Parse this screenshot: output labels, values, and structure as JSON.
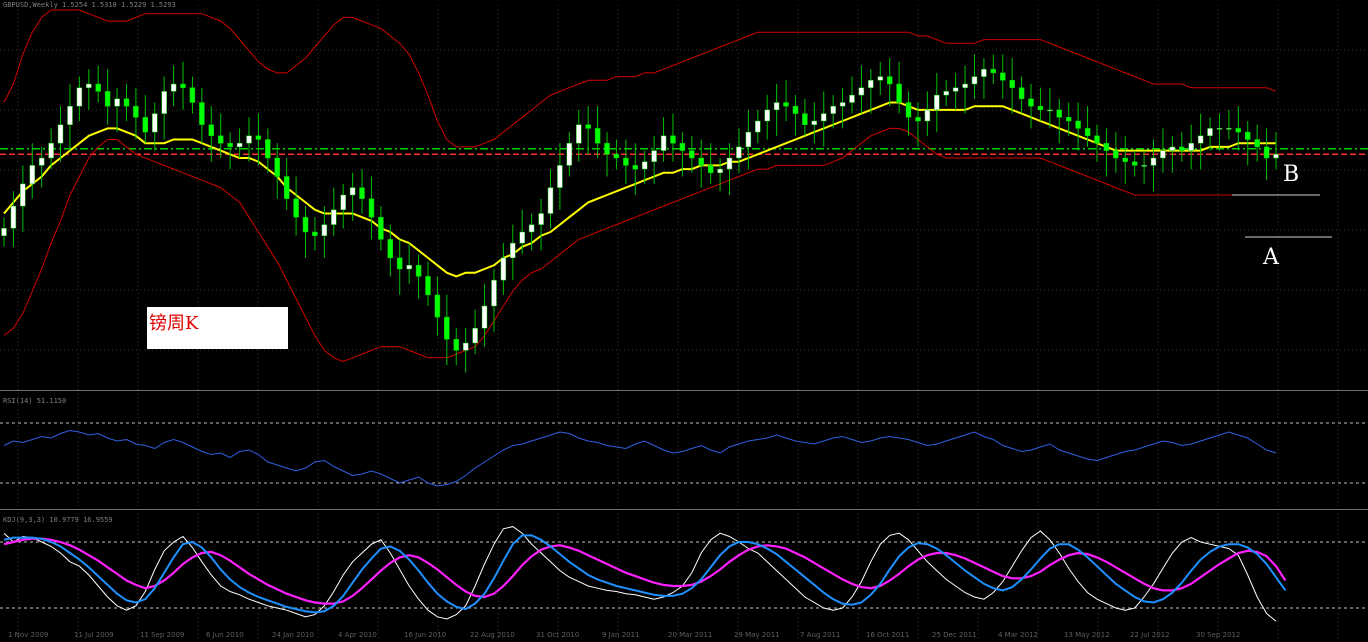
{
  "main_header": "GBPUSD,Weekly  1.5254 1.5318 1.5229 1.5293",
  "rsi_header": "RSI(14) 51.1150",
  "stoch_header": "KDJ(9,3,3) 10.9779 16.9559",
  "note": {
    "text": "镑周K"
  },
  "labels": {
    "a": "A",
    "b": "B"
  },
  "x_ticks": [
    "1 Nov 2009",
    "11 Jul 2009",
    "11 Sep 2009",
    "6 Jun 2010",
    "24 Jan 2010",
    "4 Apr 2010",
    "16 Jun 2010",
    "22 Aug 2010",
    "31 Oct 2010",
    "9 Jan 2011",
    "20 Mar 2011",
    "29 May 2011",
    "7 Aug 2011",
    "16 Oct 2011",
    "25 Dec 2011",
    "4 Mar 2012",
    "13 May 2012",
    "22 Jul 2012",
    "30 Sep 2012"
  ],
  "colors": {
    "background": "#000000",
    "grid": "#2f2f2f",
    "bull": "#ffffff",
    "bear": "#00ff00",
    "wick": "#00c000",
    "bollinger": "#d00000",
    "ma": "#ffff00",
    "support_green": "#00d000",
    "support_red": "#ff3030",
    "rsi": "#3060e0",
    "stoch_k": "#ffffff",
    "stoch_d": "#1e90ff",
    "stoch_s": "#ff20ff",
    "level": "#c0c0c0"
  },
  "chart_data": {
    "type": "line",
    "series": [
      {
        "name": "close",
        "values": [
          41,
          47,
          53,
          58,
          60,
          64,
          69,
          74,
          79,
          80,
          78,
          74,
          76,
          74,
          71,
          67,
          72,
          78,
          80,
          79,
          75,
          69,
          66,
          64,
          63,
          64,
          66,
          65,
          60,
          55,
          49,
          44,
          40,
          39,
          42,
          46,
          50,
          52,
          49,
          44,
          38,
          33,
          30,
          31,
          28,
          23,
          17,
          11,
          8,
          10,
          14,
          20,
          27,
          33,
          37,
          40,
          42,
          45,
          52,
          58,
          64,
          69,
          68,
          64,
          61,
          60,
          58,
          57,
          59,
          62,
          66,
          64,
          62,
          60,
          58,
          56,
          57,
          60,
          63,
          67,
          70,
          73,
          75,
          74,
          72,
          69,
          70,
          72,
          74,
          75,
          77,
          79,
          81,
          82,
          80,
          75,
          71,
          70,
          73,
          77,
          78,
          79,
          80,
          82,
          84,
          83,
          81,
          79,
          76,
          74,
          73,
          73,
          71,
          70,
          68,
          66,
          64,
          62,
          60,
          59,
          58,
          58,
          60,
          62,
          63,
          62,
          64,
          66,
          68,
          68,
          68,
          67,
          65,
          63,
          60,
          61
        ]
      },
      {
        "name": "ma",
        "values": [
          45,
          48,
          51,
          53,
          55,
          58,
          60,
          62,
          64,
          66,
          67,
          68,
          68,
          67,
          66,
          64,
          64,
          64,
          65,
          65,
          65,
          64,
          63,
          62,
          61,
          60,
          60,
          59,
          57,
          55,
          52,
          50,
          48,
          46,
          45,
          45,
          45,
          45,
          44,
          43,
          41,
          40,
          38,
          37,
          35,
          33,
          31,
          29,
          28,
          29,
          29,
          30,
          31,
          33,
          34,
          36,
          37,
          39,
          40,
          42,
          44,
          46,
          48,
          49,
          50,
          51,
          52,
          53,
          54,
          55,
          56,
          56,
          57,
          57,
          58,
          58,
          58,
          59,
          59,
          60,
          61,
          62,
          63,
          64,
          65,
          66,
          67,
          68,
          69,
          70,
          71,
          72,
          73,
          74,
          75,
          75,
          74,
          73,
          73,
          73,
          73,
          73,
          73,
          74,
          74,
          74,
          74,
          73,
          72,
          71,
          70,
          69,
          68,
          67,
          66,
          65,
          64,
          63,
          62,
          62,
          62,
          62,
          62,
          62,
          62,
          62,
          62,
          62,
          63,
          63,
          63,
          64,
          64,
          64,
          64,
          64
        ]
      },
      {
        "name": "bb_upper",
        "values": [
          75,
          80,
          88,
          94,
          98,
          100,
          100,
          100,
          100,
          99,
          98,
          97,
          97,
          97,
          98,
          99,
          99,
          99,
          99,
          99,
          99,
          99,
          98,
          97,
          95,
          92,
          89,
          86,
          84,
          83,
          83,
          85,
          87,
          90,
          93,
          96,
          98,
          98,
          97,
          96,
          95,
          93,
          91,
          88,
          83,
          77,
          70,
          65,
          63,
          63,
          63,
          64,
          65,
          67,
          69,
          71,
          73,
          75,
          77,
          78,
          79,
          80,
          81,
          81,
          81,
          82,
          82,
          82,
          83,
          83,
          84,
          85,
          86,
          87,
          88,
          89,
          90,
          91,
          92,
          93,
          94,
          94,
          94,
          94,
          94,
          94,
          94,
          94,
          94,
          94,
          94,
          94,
          94,
          94,
          94,
          94,
          94,
          93,
          93,
          92,
          91,
          91,
          91,
          91,
          92,
          92,
          92,
          92,
          92,
          92,
          92,
          91,
          90,
          89,
          88,
          87,
          86,
          85,
          84,
          83,
          82,
          81,
          80,
          80,
          80,
          80,
          79,
          79,
          79,
          79,
          79,
          79,
          79,
          79,
          79,
          78
        ]
      },
      {
        "name": "bb_lower",
        "values": [
          12,
          14,
          18,
          24,
          30,
          37,
          43,
          50,
          55,
          60,
          63,
          65,
          65,
          63,
          61,
          60,
          59,
          58,
          57,
          56,
          55,
          54,
          53,
          52,
          50,
          48,
          44,
          40,
          36,
          32,
          27,
          22,
          17,
          12,
          8,
          6,
          5,
          6,
          7,
          8,
          9,
          9,
          9,
          8,
          7,
          6,
          6,
          6,
          7,
          8,
          9,
          12,
          16,
          20,
          24,
          27,
          29,
          30,
          32,
          34,
          36,
          38,
          39,
          40,
          41,
          42,
          43,
          44,
          45,
          46,
          47,
          48,
          49,
          50,
          51,
          52,
          53,
          54,
          55,
          56,
          57,
          57,
          58,
          58,
          58,
          58,
          58,
          58,
          59,
          60,
          62,
          64,
          66,
          67,
          68,
          68,
          67,
          65,
          63,
          61,
          60,
          60,
          60,
          60,
          60,
          60,
          60,
          60,
          60,
          60,
          60,
          59,
          58,
          57,
          56,
          55,
          54,
          53,
          52,
          51,
          50,
          50,
          50,
          50,
          50,
          50,
          50,
          50,
          50,
          50,
          50,
          50,
          50,
          50,
          50,
          50
        ]
      }
    ],
    "support_levels": [
      62.5,
      61.0
    ],
    "rsi": {
      "levels": [
        70,
        30
      ],
      "values": [
        55,
        58,
        57,
        59,
        61,
        60,
        63,
        65,
        64,
        62,
        63,
        60,
        58,
        59,
        56,
        55,
        53,
        57,
        59,
        57,
        54,
        51,
        49,
        50,
        47,
        51,
        52,
        49,
        44,
        42,
        40,
        38,
        40,
        44,
        45,
        41,
        38,
        35,
        36,
        38,
        36,
        33,
        30,
        32,
        34,
        30,
        28,
        29,
        31,
        35,
        40,
        44,
        48,
        52,
        55,
        56,
        58,
        60,
        62,
        64,
        63,
        60,
        58,
        57,
        55,
        54,
        53,
        56,
        58,
        55,
        52,
        50,
        51,
        53,
        55,
        52,
        50,
        54,
        56,
        58,
        59,
        60,
        62,
        60,
        58,
        57,
        56,
        58,
        60,
        61,
        59,
        57,
        58,
        60,
        61,
        60,
        59,
        57,
        55,
        56,
        58,
        60,
        62,
        64,
        61,
        59,
        55,
        53,
        51,
        52,
        54,
        56,
        52,
        50,
        48,
        46,
        45,
        47,
        49,
        51,
        52,
        54,
        56,
        58,
        57,
        55,
        56,
        58,
        60,
        62,
        64,
        62,
        60,
        56,
        52,
        50
      ]
    },
    "stoch": {
      "levels": [
        80,
        20
      ],
      "k": [
        88,
        80,
        85,
        84,
        80,
        76,
        70,
        62,
        58,
        50,
        40,
        30,
        22,
        18,
        22,
        35,
        55,
        72,
        80,
        85,
        75,
        62,
        50,
        40,
        35,
        32,
        28,
        25,
        22,
        20,
        18,
        15,
        12,
        14,
        22,
        35,
        50,
        62,
        70,
        78,
        82,
        70,
        55,
        40,
        28,
        18,
        12,
        10,
        14,
        22,
        40,
        60,
        78,
        92,
        94,
        88,
        78,
        70,
        62,
        54,
        48,
        44,
        40,
        38,
        36,
        35,
        33,
        32,
        30,
        28,
        30,
        34,
        40,
        52,
        70,
        82,
        88,
        85,
        80,
        74,
        70,
        62,
        54,
        46,
        38,
        30,
        25,
        20,
        18,
        20,
        30,
        44,
        62,
        78,
        86,
        88,
        82,
        72,
        62,
        54,
        46,
        40,
        34,
        30,
        28,
        34,
        44,
        58,
        72,
        84,
        90,
        82,
        70,
        56,
        44,
        34,
        28,
        24,
        20,
        18,
        20,
        30,
        42,
        56,
        70,
        80,
        84,
        80,
        78,
        76,
        74,
        68,
        50,
        30,
        15,
        8
      ],
      "d": [
        82,
        84,
        84,
        84,
        83,
        80,
        76,
        70,
        64,
        57,
        49,
        41,
        33,
        27,
        25,
        28,
        38,
        52,
        66,
        78,
        80,
        75,
        66,
        55,
        46,
        39,
        34,
        30,
        27,
        24,
        21,
        19,
        17,
        16,
        17,
        22,
        31,
        43,
        55,
        65,
        74,
        76,
        72,
        64,
        54,
        43,
        33,
        26,
        21,
        19,
        24,
        33,
        47,
        63,
        78,
        86,
        86,
        82,
        76,
        69,
        62,
        56,
        50,
        46,
        43,
        40,
        38,
        36,
        34,
        32,
        31,
        31,
        33,
        38,
        46,
        57,
        68,
        76,
        80,
        80,
        78,
        74,
        69,
        62,
        55,
        48,
        41,
        34,
        28,
        24,
        23,
        25,
        32,
        42,
        55,
        67,
        75,
        79,
        78,
        74,
        68,
        61,
        54,
        48,
        42,
        38,
        36,
        39,
        46,
        55,
        65,
        74,
        78,
        78,
        73,
        66,
        58,
        50,
        42,
        36,
        30,
        26,
        25,
        28,
        34,
        43,
        54,
        64,
        71,
        76,
        78,
        78,
        75,
        69,
        60,
        48,
        36
      ],
      "s": [
        78,
        80,
        82,
        83,
        83,
        82,
        80,
        77,
        73,
        68,
        63,
        57,
        51,
        45,
        41,
        38,
        40,
        45,
        52,
        60,
        66,
        70,
        71,
        68,
        63,
        57,
        51,
        46,
        41,
        37,
        33,
        30,
        27,
        25,
        24,
        24,
        26,
        31,
        38,
        46,
        54,
        61,
        66,
        68,
        66,
        61,
        55,
        48,
        41,
        35,
        31,
        30,
        33,
        40,
        49,
        59,
        67,
        73,
        76,
        77,
        75,
        72,
        68,
        64,
        60,
        56,
        52,
        49,
        46,
        43,
        41,
        40,
        40,
        41,
        44,
        49,
        55,
        62,
        68,
        73,
        76,
        77,
        76,
        74,
        70,
        66,
        61,
        56,
        51,
        46,
        42,
        39,
        38,
        40,
        45,
        51,
        58,
        64,
        68,
        70,
        70,
        68,
        65,
        61,
        57,
        53,
        49,
        47,
        47,
        49,
        53,
        59,
        64,
        68,
        70,
        69,
        66,
        62,
        57,
        52,
        47,
        42,
        38,
        36,
        36,
        38,
        42,
        48,
        54,
        60,
        65,
        70,
        72,
        71,
        67,
        58,
        45
      ]
    }
  }
}
